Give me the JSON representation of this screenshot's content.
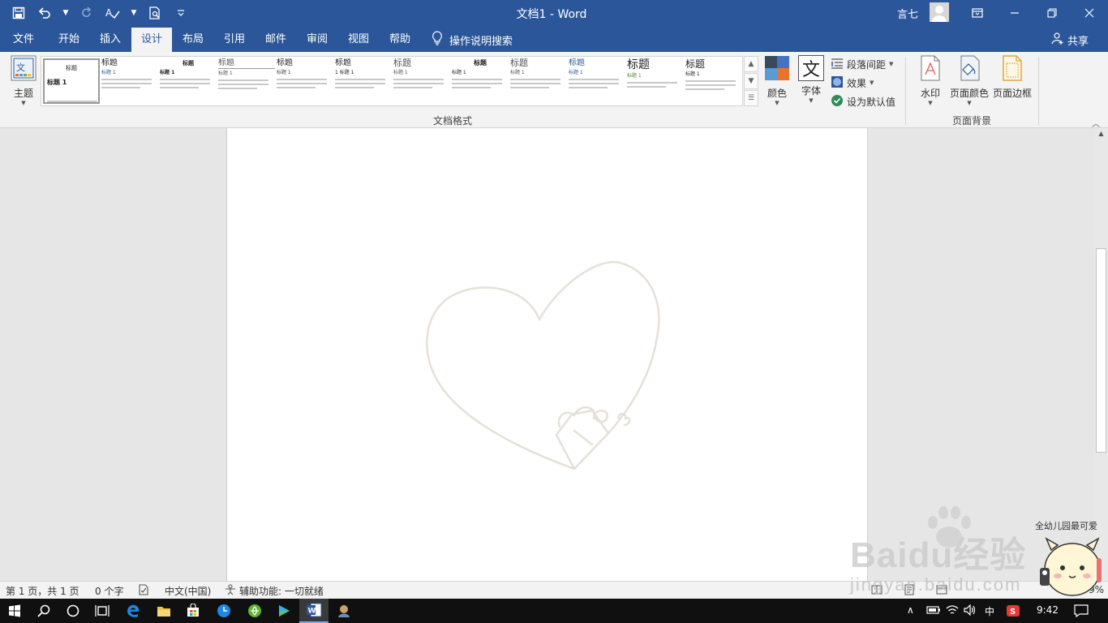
{
  "app": {
    "doc_title": "文档1",
    "separator": " - ",
    "app_name": "Word",
    "user_name": "言七",
    "colors": {
      "brand": "#2b579a",
      "ribbon_bg": "#f3f3f3",
      "taskbar": "#101010",
      "accent_theme_color": "#e7742d"
    }
  },
  "qat": {
    "icons": [
      "save-icon",
      "undo-icon",
      "redo-icon",
      "spelling-icon",
      "print-preview-icon",
      "customize-qat-icon"
    ]
  },
  "tabs": [
    {
      "label": "文件"
    },
    {
      "label": "开始"
    },
    {
      "label": "插入"
    },
    {
      "label": "设计",
      "active": true
    },
    {
      "label": "布局"
    },
    {
      "label": "引用"
    },
    {
      "label": "邮件"
    },
    {
      "label": "审阅"
    },
    {
      "label": "视图"
    },
    {
      "label": "帮助"
    }
  ],
  "tell_me": {
    "label": "操作说明搜索",
    "icon": "lightbulb-icon"
  },
  "share": {
    "label": "共享",
    "icon": "person-icon"
  },
  "ribbon": {
    "theme": {
      "label": "主题",
      "icon": "theme-icon"
    },
    "gallery_items": [
      {
        "title": "标题",
        "heading": "标题 1"
      },
      {
        "title": "标题",
        "heading": "标题 1"
      },
      {
        "title": "标题",
        "heading": "标题 1"
      },
      {
        "title": "标题",
        "heading": "标题 1"
      },
      {
        "title": "标题",
        "heading": "标题 1"
      },
      {
        "title": "标题",
        "heading": "1 标题 1"
      },
      {
        "title": "标题",
        "heading": "标题 1"
      },
      {
        "title": "标题",
        "heading": "标题 1"
      },
      {
        "title": "标题",
        "heading": "标题 1"
      },
      {
        "title": "标题",
        "heading": "标题 1"
      },
      {
        "title": "标题",
        "heading": "标题 1"
      },
      {
        "title": "标题",
        "heading": "标题 1"
      }
    ],
    "colors_btn": {
      "label": "颜色",
      "icon": "theme-colors-icon"
    },
    "fonts_btn": {
      "label": "字体",
      "glyph": "文",
      "icon": "theme-fonts-icon"
    },
    "paragraph_spacing": {
      "label": "段落间距",
      "icon": "paragraph-spacing-icon"
    },
    "effects": {
      "label": "效果",
      "icon": "effects-icon"
    },
    "set_default": {
      "label": "设为默认值",
      "icon": "checkmark-icon"
    },
    "doc_format_group": "文档格式",
    "watermark": {
      "label": "水印",
      "icon": "watermark-icon"
    },
    "page_color": {
      "label": "页面颜色",
      "icon": "page-color-icon"
    },
    "page_borders": {
      "label": "页面边框",
      "icon": "page-border-icon"
    },
    "page_background_group": "页面背景"
  },
  "statusbar": {
    "page": "第 1 页，共 1 页",
    "words": "0 个字",
    "language": "中文(中国)",
    "accessibility": "辅助功能: 一切就绪",
    "zoom": "9%"
  },
  "taskbar": {
    "icons": [
      "windows-start-icon",
      "search-icon",
      "cortana-icon",
      "task-view-icon",
      "edge-icon",
      "file-explorer-icon",
      "store-icon",
      "clock-app-icon",
      "browser-icon",
      "media-player-icon",
      "word-icon",
      "app-icon"
    ],
    "tray": {
      "ime": "中",
      "time": "9:42"
    }
  },
  "watermark": {
    "brand": "Baidu经验",
    "url": "jingyan.baidu.com",
    "tag": "全幼儿园最可爱"
  }
}
